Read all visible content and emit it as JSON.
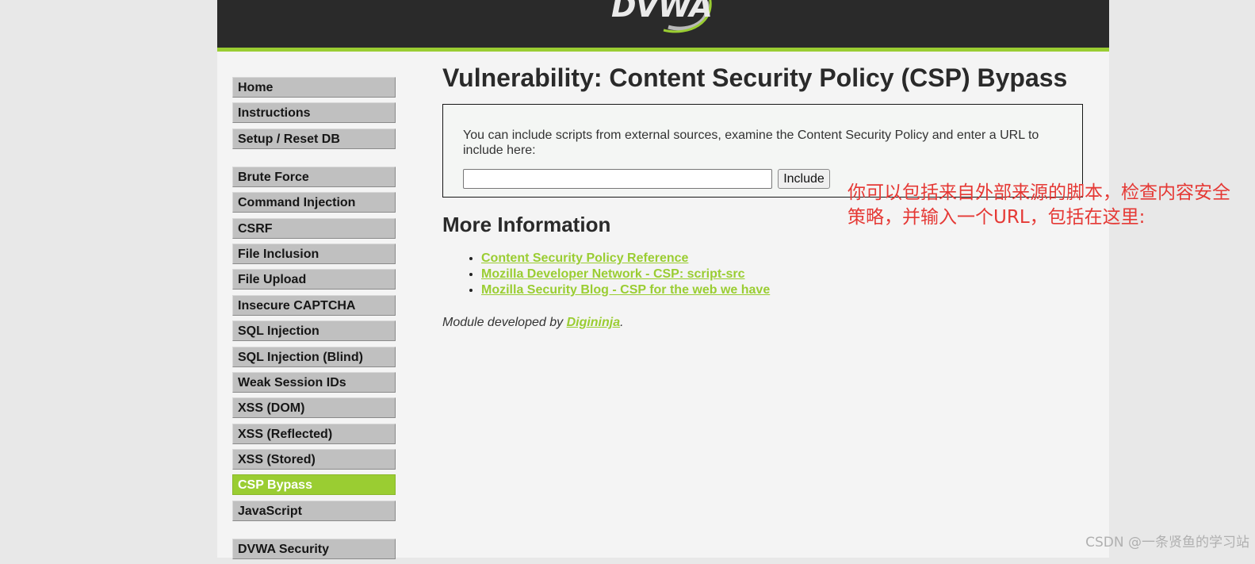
{
  "header": {
    "logo_text": "DVWA"
  },
  "menu": {
    "groups": [
      [
        {
          "label": "Home"
        },
        {
          "label": "Instructions"
        },
        {
          "label": "Setup / Reset DB"
        }
      ],
      [
        {
          "label": "Brute Force"
        },
        {
          "label": "Command Injection"
        },
        {
          "label": "CSRF"
        },
        {
          "label": "File Inclusion"
        },
        {
          "label": "File Upload"
        },
        {
          "label": "Insecure CAPTCHA"
        },
        {
          "label": "SQL Injection"
        },
        {
          "label": "SQL Injection (Blind)"
        },
        {
          "label": "Weak Session IDs"
        },
        {
          "label": "XSS (DOM)"
        },
        {
          "label": "XSS (Reflected)"
        },
        {
          "label": "XSS (Stored)"
        },
        {
          "label": "CSP Bypass",
          "selected": true
        },
        {
          "label": "JavaScript"
        }
      ],
      [
        {
          "label": "DVWA Security"
        }
      ]
    ]
  },
  "main": {
    "title": "Vulnerability: Content Security Policy (CSP) Bypass",
    "intro": "You can include scripts from external sources, examine the Content Security Policy and enter a URL to include here:",
    "url_input": {
      "value": "",
      "placeholder": ""
    },
    "include_button": "Include",
    "more_info_heading": "More Information",
    "links": [
      "Content Security Policy Reference",
      "Mozilla Developer Network - CSP: script-src",
      "Mozilla Security Blog - CSP for the web we have"
    ],
    "credit_prefix": "Module developed by ",
    "credit_author": "Digininja",
    "credit_suffix": "."
  },
  "annotation": {
    "text": "你可以包括来自外部来源的脚本，检查内容安全策略，并输入一个URL，包括在这里:"
  },
  "watermark": {
    "text": "CSDN @一条贤鱼的学习站"
  },
  "colors": {
    "accent": "#9acd32",
    "header_bg": "#2a2a2a",
    "page_bg": "#f4f4f4",
    "annotation": "#e53935"
  }
}
